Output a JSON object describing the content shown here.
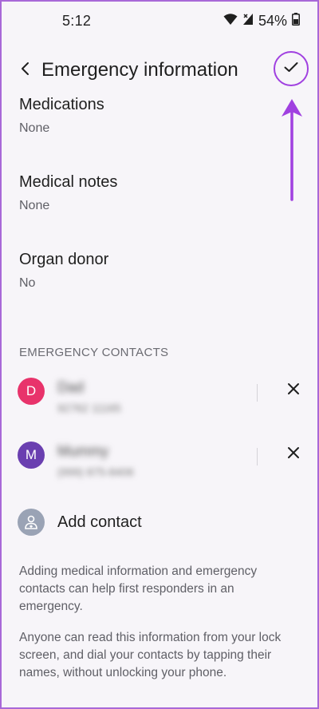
{
  "status_bar": {
    "time": "5:12",
    "battery": "54%",
    "icons": [
      "wifi-icon",
      "signal-icon",
      "battery-icon"
    ]
  },
  "header": {
    "title": "Emergency information",
    "back_icon": "chevron-left-icon",
    "save_icon": "checkmark-icon"
  },
  "fields": [
    {
      "label": "Medications",
      "value": "None"
    },
    {
      "label": "Medical notes",
      "value": "None"
    },
    {
      "label": "Organ donor",
      "value": "No"
    }
  ],
  "emergency_contacts": {
    "header": "EMERGENCY CONTACTS",
    "contacts": [
      {
        "initial": "D",
        "name": "Dad",
        "phone": "92762 11165",
        "color": "#e8336b"
      },
      {
        "initial": "M",
        "name": "Mummy",
        "phone": "(999) 875-8406",
        "color": "#6a3fb0"
      }
    ],
    "add_label": "Add contact"
  },
  "info": [
    "Adding medical information and emergency contacts can help first responders in an emergency.",
    "Anyone can read this information from your lock screen, and dial your contacts by tapping their names, without unlocking your phone."
  ],
  "colors": {
    "accent": "#a040e0",
    "frame_border": "#a868d8",
    "background": "#f7f5f9"
  }
}
